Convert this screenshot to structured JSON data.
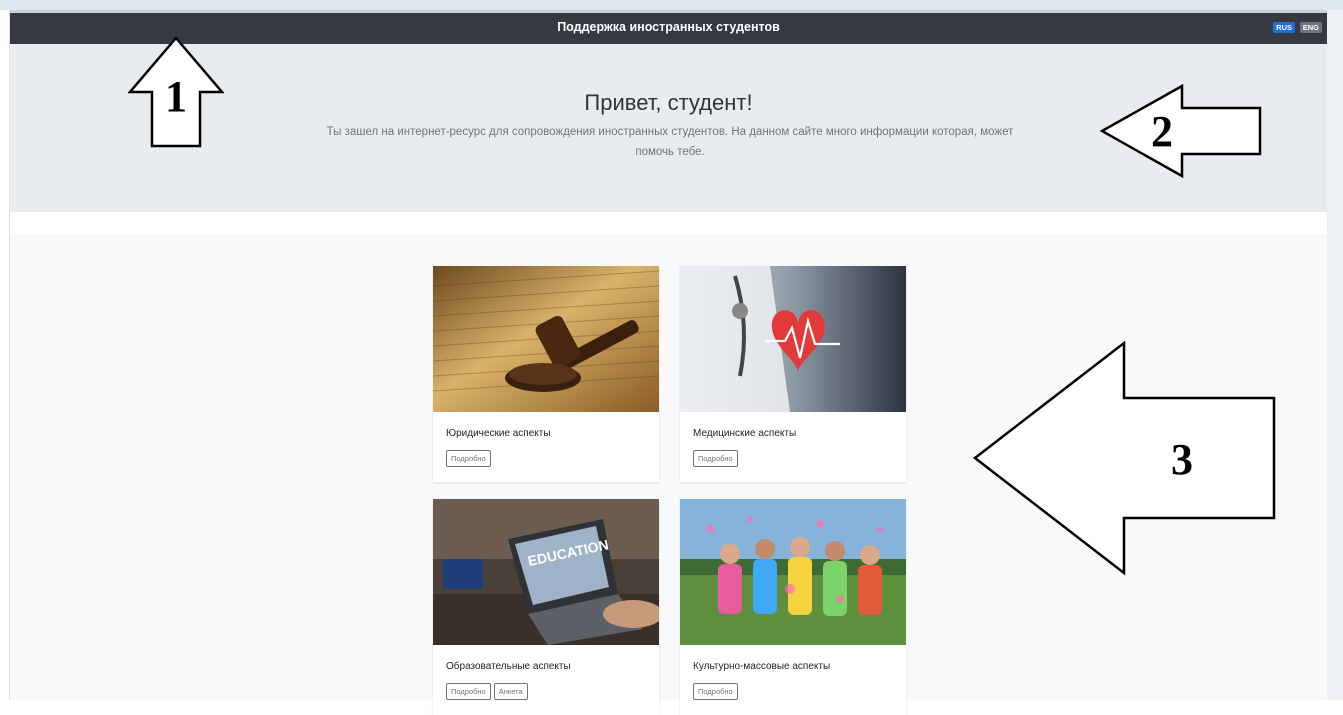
{
  "navbar": {
    "title": "Поддержка иностранных студентов",
    "lang_rus": "RUS",
    "lang_eng": "ENG"
  },
  "jumbotron": {
    "heading": "Привет, студент!",
    "text": "Ты зашел на интернет-ресурс для сопровождения иностранных студентов. На данном сайте много информации которая, может помочь тебе."
  },
  "cards": [
    {
      "title": "Юридические аспекты",
      "buttons": [
        "Подробно"
      ]
    },
    {
      "title": "Медицинские аспекты",
      "buttons": [
        "Подробно"
      ]
    },
    {
      "title": "Образовательные аспекты",
      "buttons": [
        "Подробно",
        "Анкета"
      ]
    },
    {
      "title": "Культурно-массовые аспекты",
      "buttons": [
        "Подробно"
      ]
    }
  ],
  "card_images": {
    "education_text": "EDUCATION"
  },
  "annotations": [
    "1",
    "2",
    "3"
  ],
  "colors": {
    "navbar": "#343a40",
    "jumbotron": "#e9ecef",
    "album": "#f8f9fa",
    "lang_active": "#1f6fd6"
  }
}
